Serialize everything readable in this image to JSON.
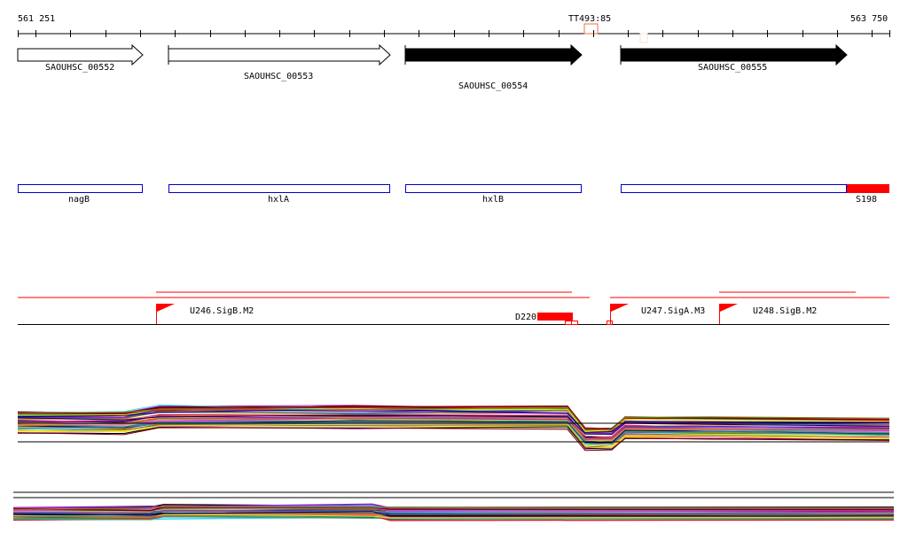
{
  "ruler": {
    "start_label": "561 251",
    "end_label": "563 750",
    "marker_label": "TT493:85"
  },
  "genes": [
    {
      "label": "SAOUHSC_00552",
      "strand": "+",
      "fill": "#ffffff"
    },
    {
      "label": "SAOUHSC_00553",
      "strand": "+",
      "fill": "#ffffff"
    },
    {
      "label": "SAOUHSC_00554",
      "strand": "+",
      "fill": "#000000"
    },
    {
      "label": "SAOUHSC_00555",
      "strand": "+",
      "fill": "#000000"
    }
  ],
  "features": [
    {
      "label": "nagB"
    },
    {
      "label": "hxlA"
    },
    {
      "label": "hxlB"
    },
    {
      "label": "S198"
    }
  ],
  "regulatory": {
    "promoters": [
      {
        "label": "U246.SigB.M2"
      },
      {
        "label": "U247.SigA.M3"
      },
      {
        "label": "U248.SigB.M2"
      }
    ],
    "terminator": {
      "label": "D220"
    }
  },
  "colors": {
    "feature_outline": "#0000cc",
    "accent": "#ff0000",
    "marker": "#f26c4f"
  }
}
